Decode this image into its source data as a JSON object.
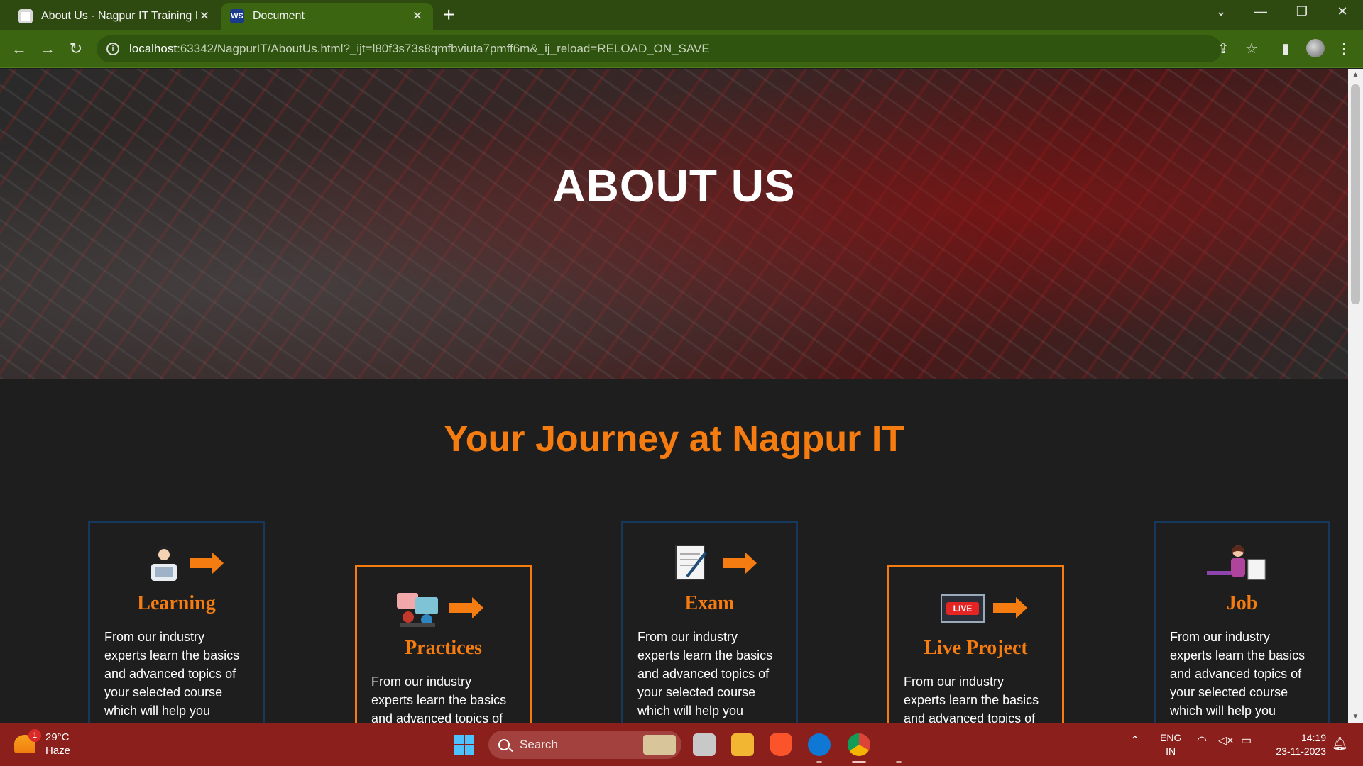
{
  "browser": {
    "tabs": [
      {
        "title": "About Us - Nagpur IT Training Ir",
        "active": false
      },
      {
        "title": "Document",
        "active": true
      }
    ],
    "url": {
      "host": "localhost",
      "rest": ":63342/NagpurIT/AboutUs.html?_ijt=l80f3s73s8qmfbviuta7pmff6m&_ij_reload=RELOAD_ON_SAVE"
    }
  },
  "page": {
    "hero_title": "ABOUT US",
    "section_title": "Your Journey at Nagpur IT",
    "cards": [
      {
        "title": "Learning",
        "text": "From our industry experts learn the basics and advanced topics of your selected course which will help you become master."
      },
      {
        "title": "Practices",
        "text": "From our industry experts learn the basics and advanced topics of your selected course which will help you become master."
      },
      {
        "title": "Exam",
        "text": "From our industry experts learn the basics and advanced topics of your selected course which will help you become master."
      },
      {
        "title": "Live Project",
        "badge": "LIVE",
        "text": "From our industry experts learn the basics and advanced topics of your selected course which will help you become master."
      },
      {
        "title": "Job",
        "text": "From our industry experts learn the basics and advanced topics of your selected course which will help you become master."
      }
    ]
  },
  "taskbar": {
    "weather": {
      "temp": "29°C",
      "condition": "Haze",
      "badge": "1"
    },
    "search_placeholder": "Search",
    "language": {
      "line1": "ENG",
      "line2": "IN"
    },
    "clock": {
      "time": "14:19",
      "date": "23-11-2023"
    }
  },
  "colors": {
    "accent": "#f57c10",
    "card_border": "#16385c",
    "browser_frame": "#3b6510",
    "taskbar": "#8b1f1c"
  }
}
